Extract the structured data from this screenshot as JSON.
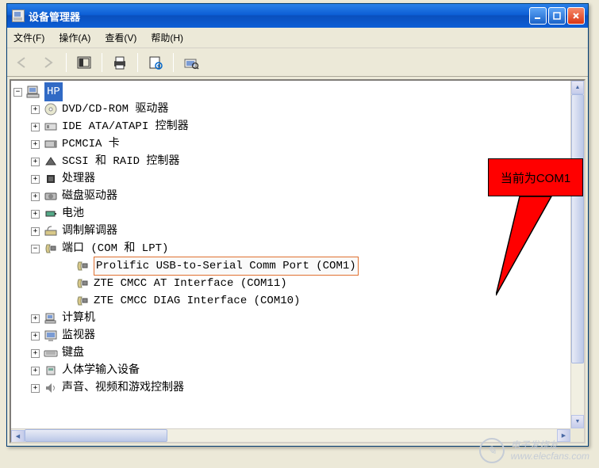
{
  "window": {
    "title": "设备管理器"
  },
  "menu": {
    "file": "文件(F)",
    "action": "操作(A)",
    "view": "查看(V)",
    "help": "帮助(H)"
  },
  "tree": {
    "root": "HP",
    "items": [
      {
        "label": "DVD/CD-ROM 驱动器"
      },
      {
        "label": "IDE ATA/ATAPI 控制器"
      },
      {
        "label": "PCMCIA 卡"
      },
      {
        "label": "SCSI 和 RAID 控制器"
      },
      {
        "label": "处理器"
      },
      {
        "label": "磁盘驱动器"
      },
      {
        "label": "电池"
      },
      {
        "label": "调制解调器"
      }
    ],
    "ports": {
      "label": "端口 (COM 和 LPT)",
      "children": [
        {
          "label": "Prolific USB-to-Serial Comm Port (COM1)",
          "highlighted": true
        },
        {
          "label": "ZTE CMCC AT Interface (COM11)"
        },
        {
          "label": "ZTE CMCC DIAG Interface (COM10)"
        }
      ]
    },
    "items_after": [
      {
        "label": "计算机"
      },
      {
        "label": "监视器"
      },
      {
        "label": "键盘"
      },
      {
        "label": "人体学输入设备"
      },
      {
        "label": "声音、视频和游戏控制器"
      }
    ]
  },
  "callout": {
    "text": "当前为COM1"
  },
  "watermark": {
    "name": "电子发烧友",
    "url": "www.elecfans.com"
  }
}
